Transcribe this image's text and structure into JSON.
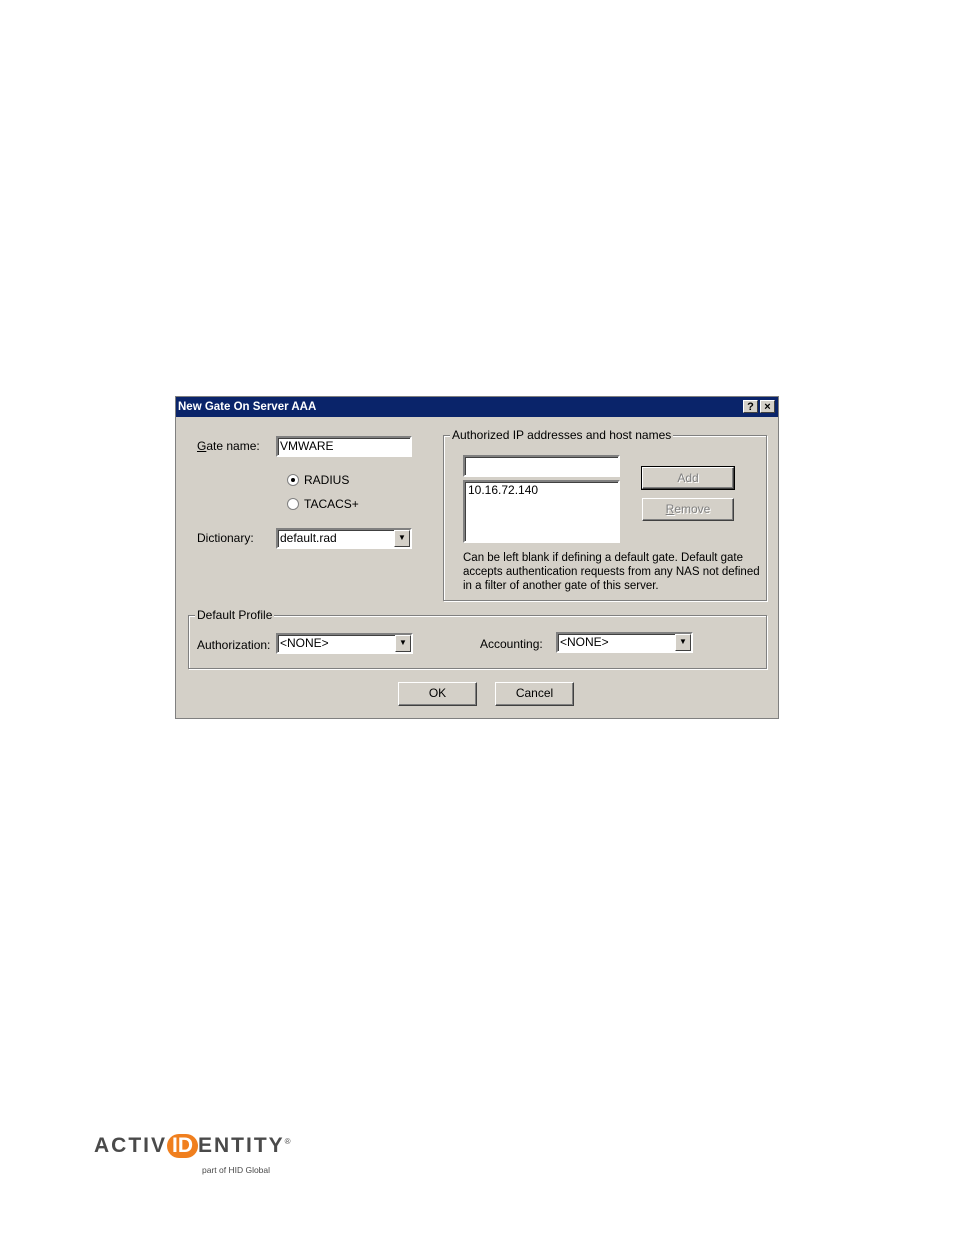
{
  "dialog": {
    "title": "New Gate On Server AAA",
    "help_label": "?",
    "close_label": "×",
    "gate_name_label_pre": "",
    "gate_name_label_u": "G",
    "gate_name_label_post": "ate name:",
    "gate_name_value": "VMWARE",
    "radio_radius_label": "RADIUS",
    "radio_tacacs_label": "TACACS+",
    "selected_protocol": "RADIUS",
    "dictionary_label": "Dictionary:",
    "dictionary_value": "default.rad",
    "authorized_group_title": "Authorized IP addresses and host names",
    "address_input_value": "",
    "address_list": [
      "10.16.72.140"
    ],
    "add_label": "Add",
    "remove_label_u": "R",
    "remove_label_post": "emove",
    "note": "Can be left blank if defining a default gate. Default gate accepts authentication requests from any NAS not defined in a filter of another gate of this server.",
    "default_profile_title": "Default Profile",
    "authorization_label": "Authorization:",
    "authorization_value": "<NONE>",
    "accounting_label": "Accounting:",
    "accounting_value": "<NONE>",
    "ok_label": "OK",
    "cancel_label": "Cancel"
  },
  "logo": {
    "text_pre": "ACTIV",
    "text_id": "ID",
    "text_post": "ENTITY",
    "registered": "®",
    "subtitle": "part of HID Global"
  }
}
